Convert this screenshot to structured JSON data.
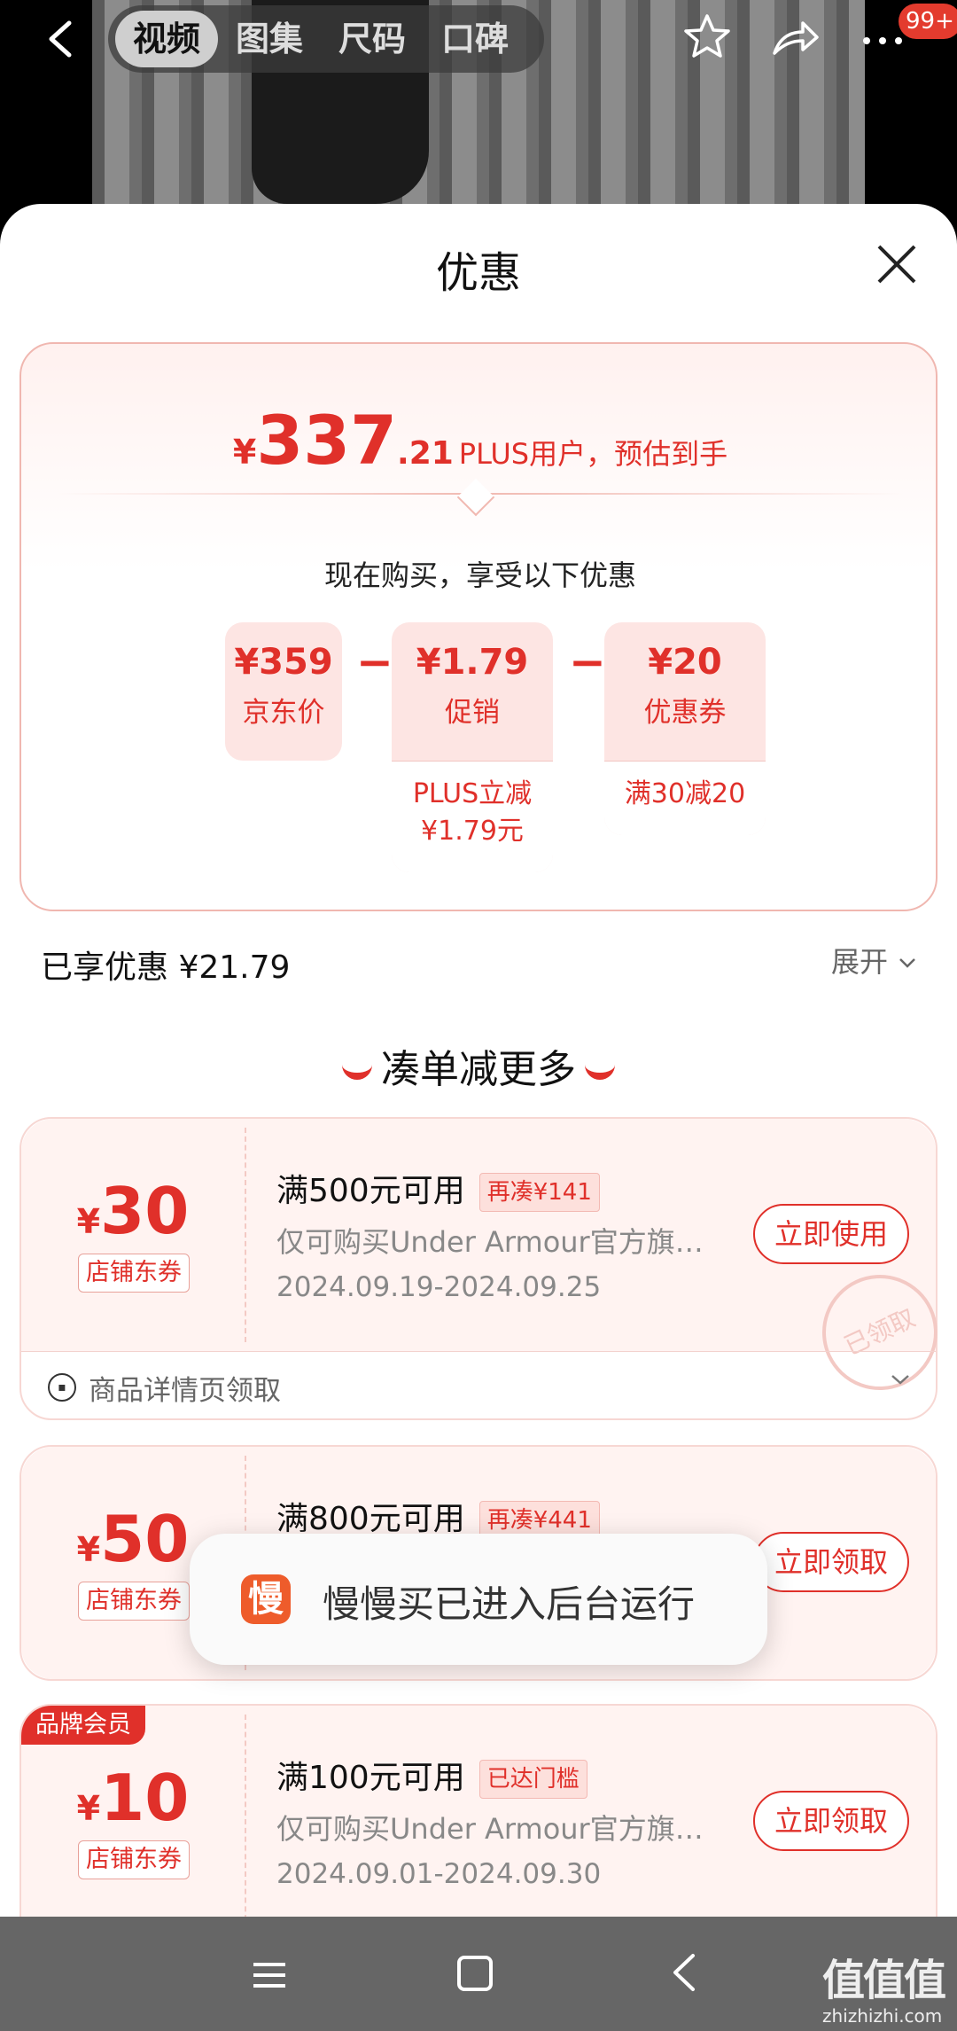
{
  "topbar": {
    "tabs": [
      "视频",
      "图集",
      "尺码",
      "口碑"
    ],
    "active_tab": "视频",
    "badge": "99+"
  },
  "sheet": {
    "title": "优惠",
    "price": {
      "currency": "¥",
      "integer": "337",
      "decimal": ".21",
      "note": "PLUS用户，预估到手"
    },
    "enjoy_text": "现在购买，享受以下优惠",
    "breakdown": [
      {
        "value": "¥359",
        "label": "京东价"
      },
      {
        "value": "¥1.79",
        "label": "促销",
        "sub": [
          "PLUS立减",
          "¥1.79元"
        ]
      },
      {
        "value": "¥20",
        "label": "优惠券",
        "sub": [
          "满30减20"
        ]
      }
    ],
    "minus_sign": "−",
    "enjoyed": "已享优惠 ¥21.79",
    "expand": "展开"
  },
  "more_title": "凑单减更多",
  "coupons": [
    {
      "currency": "¥",
      "amount": "30",
      "type": "店铺东券",
      "title": "满500元可用",
      "tag": "再凑¥141",
      "desc": "仅可购买Under Armour官方旗…",
      "date": "2024.09.19-2024.09.25",
      "button": "立即使用",
      "stamp": "已领取",
      "footer": "商品详情页领取"
    },
    {
      "currency": "¥",
      "amount": "50",
      "type": "店铺东券",
      "title": "满800元可用",
      "tag": "再凑¥441",
      "button": "立即领取"
    },
    {
      "brand_tag": "品牌会员",
      "currency": "¥",
      "amount": "10",
      "type": "店铺东券",
      "title": "满100元可用",
      "tag": "已达门槛",
      "desc": "仅可购买Under Armour官方旗…",
      "date": "2024.09.01-2024.09.30",
      "button": "立即领取"
    }
  ],
  "toast": {
    "icon_char": "慢",
    "text": "慢慢买已进入后台运行"
  },
  "watermark": {
    "main": "值值值",
    "sub": "zhizhizhi.com"
  },
  "colors": {
    "accent": "#e0302a",
    "card_bg": "#fde5e3"
  }
}
